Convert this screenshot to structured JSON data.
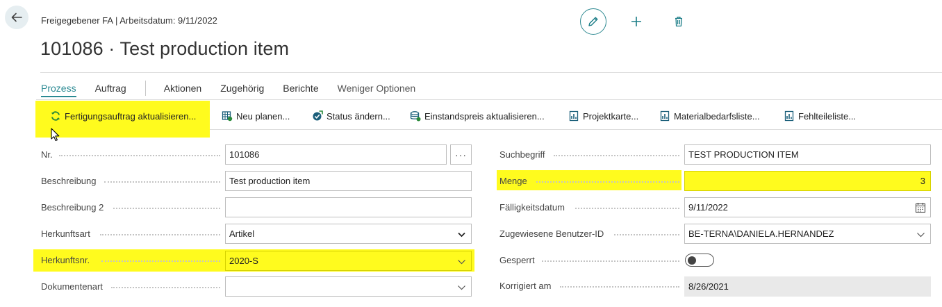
{
  "header": {
    "breadcrumb": "Freigegebener FA | Arbeitsdatum: 9/11/2022",
    "title": "101086 · Test production item"
  },
  "top_actions": {
    "edit_icon": "pencil-icon",
    "add_icon": "plus-icon",
    "delete_icon": "trash-icon"
  },
  "tabs": [
    {
      "label": "Prozess"
    },
    {
      "label": "Auftrag"
    },
    {
      "label": "Aktionen"
    },
    {
      "label": "Zugehörig"
    },
    {
      "label": "Berichte"
    },
    {
      "label": "Weniger Optionen"
    }
  ],
  "actions": [
    {
      "label": "Fertigungsauftrag aktualisieren...",
      "icon": "refresh-icon"
    },
    {
      "label": "Neu planen...",
      "icon": "replan-icon"
    },
    {
      "label": "Status ändern...",
      "icon": "status-change-icon"
    },
    {
      "label": "Einstandspreis aktualisieren...",
      "icon": "cost-update-icon"
    },
    {
      "label": "Projektkarte...",
      "icon": "report-icon"
    },
    {
      "label": "Materialbedarfsliste...",
      "icon": "report-icon"
    },
    {
      "label": "Fehlteileliste...",
      "icon": "report-icon"
    }
  ],
  "form_left": {
    "nr": {
      "label": "Nr.",
      "value": "101086",
      "assist": "···"
    },
    "beschreibung": {
      "label": "Beschreibung",
      "value": "Test production item"
    },
    "beschreibung2": {
      "label": "Beschreibung 2",
      "value": ""
    },
    "herkunftsart": {
      "label": "Herkunftsart",
      "value": "Artikel"
    },
    "herkunftsnr": {
      "label": "Herkunftsnr.",
      "value": "2020-S"
    },
    "dokumentenart": {
      "label": "Dokumentenart",
      "value": ""
    }
  },
  "form_right": {
    "suchbegriff": {
      "label": "Suchbegriff",
      "value": "TEST PRODUCTION ITEM"
    },
    "menge": {
      "label": "Menge",
      "value": "3"
    },
    "faelligkeitsdatum": {
      "label": "Fälligkeitsdatum",
      "value": "9/11/2022"
    },
    "benutzer": {
      "label": "Zugewiesene Benutzer-ID",
      "value": "BE-TERNA\\DANIELA.HERNANDEZ"
    },
    "gesperrt": {
      "label": "Gesperrt",
      "value": "Off"
    },
    "korrigiert": {
      "label": "Korrigiert am",
      "value": "8/26/2021"
    }
  },
  "colors": {
    "accent": "#2b8a93",
    "highlight": "#fffb1e",
    "icon_teal": "#1b7d87"
  }
}
